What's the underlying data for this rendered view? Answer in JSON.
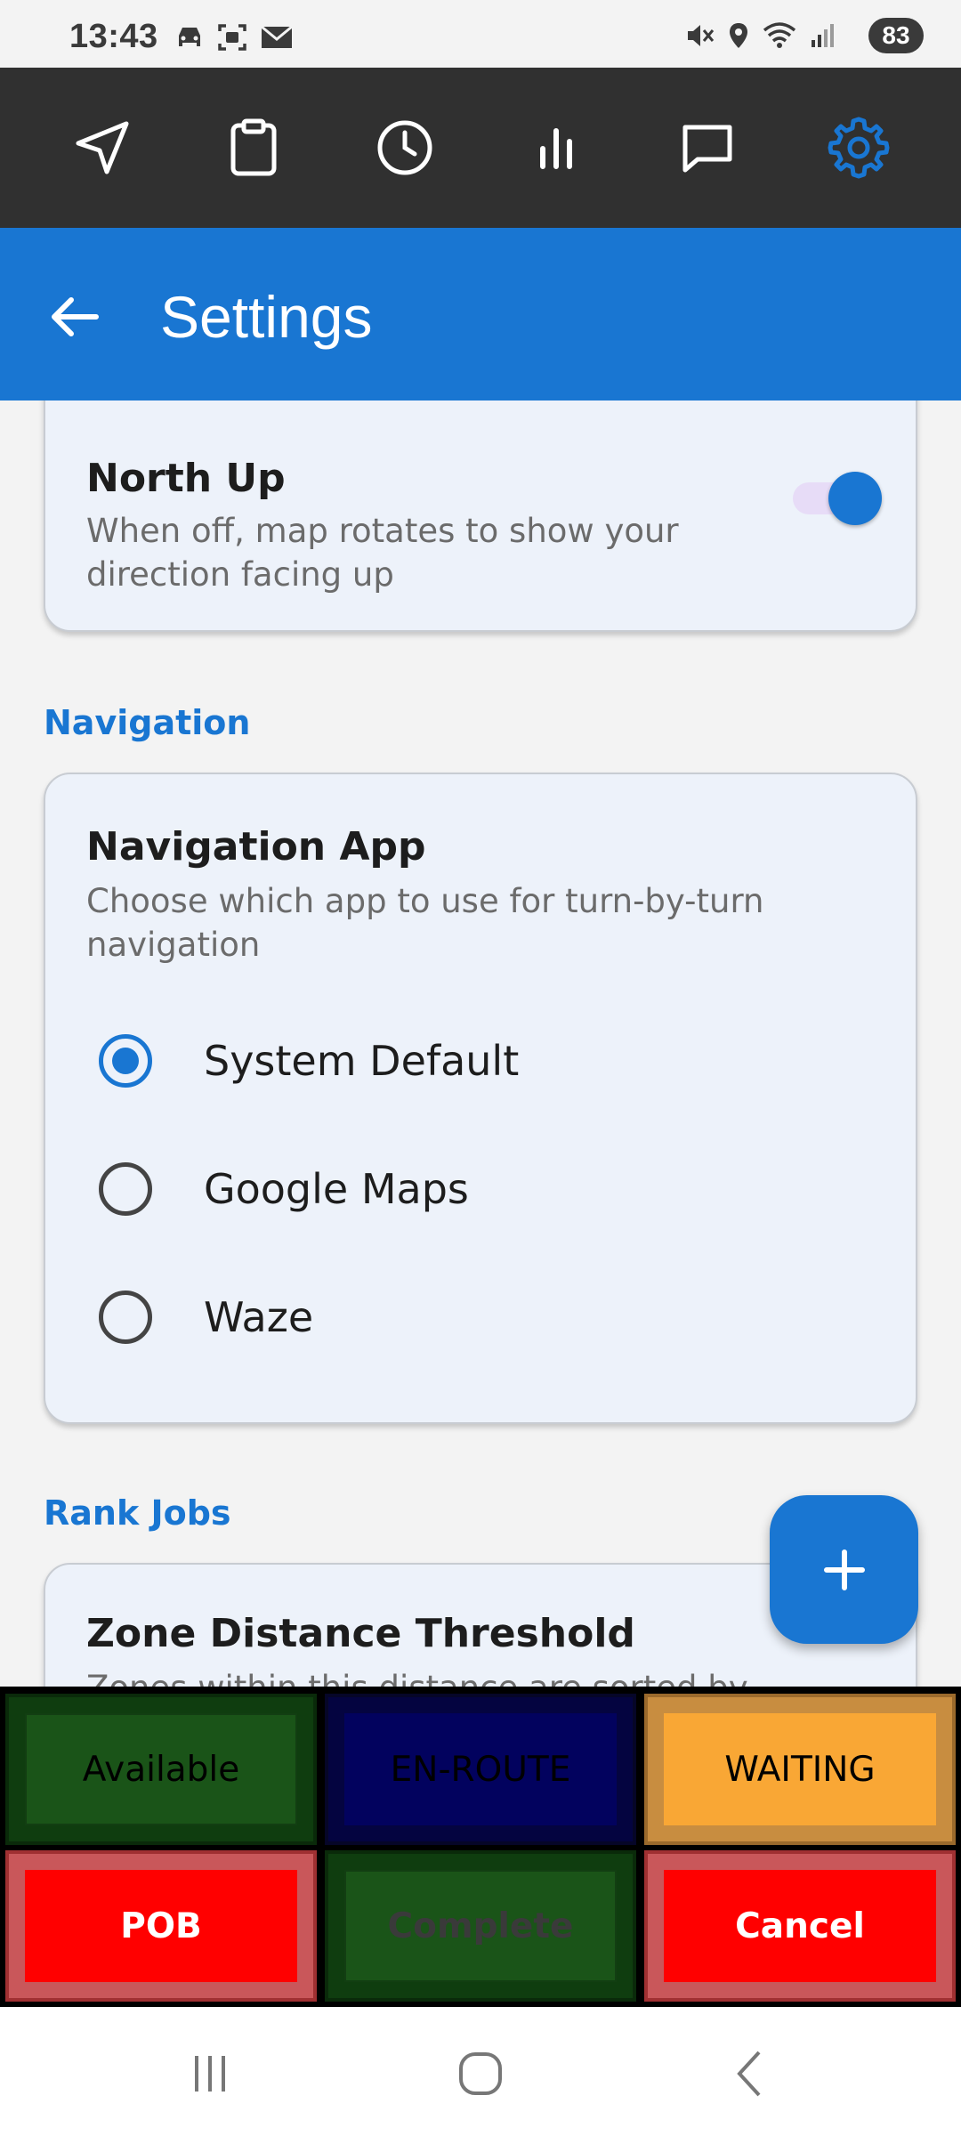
{
  "status_bar": {
    "time": "13:43",
    "battery": "83",
    "left_icons": [
      "car-icon",
      "screenshot-icon",
      "mail-icon"
    ],
    "right_icons": [
      "mute-icon",
      "location-icon",
      "wifi-icon",
      "signal-icon"
    ]
  },
  "toolbar": {
    "items": [
      {
        "icon": "navigation-arrow-icon",
        "active": false
      },
      {
        "icon": "clipboard-icon",
        "active": false
      },
      {
        "icon": "clock-icon",
        "active": false
      },
      {
        "icon": "bar-chart-icon",
        "active": false
      },
      {
        "icon": "message-icon",
        "active": false
      },
      {
        "icon": "gear-icon",
        "active": true
      }
    ]
  },
  "appbar": {
    "title": "Settings",
    "back_icon": "arrow-left-icon"
  },
  "north_up": {
    "title": "North Up",
    "description_line1": "When off, map rotates to show your",
    "description_line2": "direction facing up",
    "enabled": true
  },
  "navigation_section": {
    "label": "Navigation",
    "card_title": "Navigation App",
    "description_line1": "Choose which app to use for turn-by-turn",
    "description_line2": "navigation",
    "options": [
      {
        "label": "System Default",
        "selected": true
      },
      {
        "label": "Google Maps",
        "selected": false
      },
      {
        "label": "Waze",
        "selected": false
      }
    ]
  },
  "rank_jobs_section": {
    "label": "Rank Jobs",
    "card_title": "Zone Distance Threshold",
    "description_partial": "Zones within this distance are sorted by"
  },
  "fab": {
    "icon": "plus-icon"
  },
  "status_buttons": {
    "available": "Available",
    "en_route": "EN-ROUTE",
    "waiting": "WAITING",
    "pob": "POB",
    "complete": "Complete",
    "cancel": "Cancel"
  },
  "colors": {
    "primary": "#1976d2",
    "toolbar_bg": "#303030",
    "green": "#1a5418",
    "navy": "#02025e",
    "orange": "#f9a735",
    "red": "#ff0000"
  },
  "nav_bar": {
    "items": [
      "recents-icon",
      "home-icon",
      "back-icon"
    ]
  }
}
